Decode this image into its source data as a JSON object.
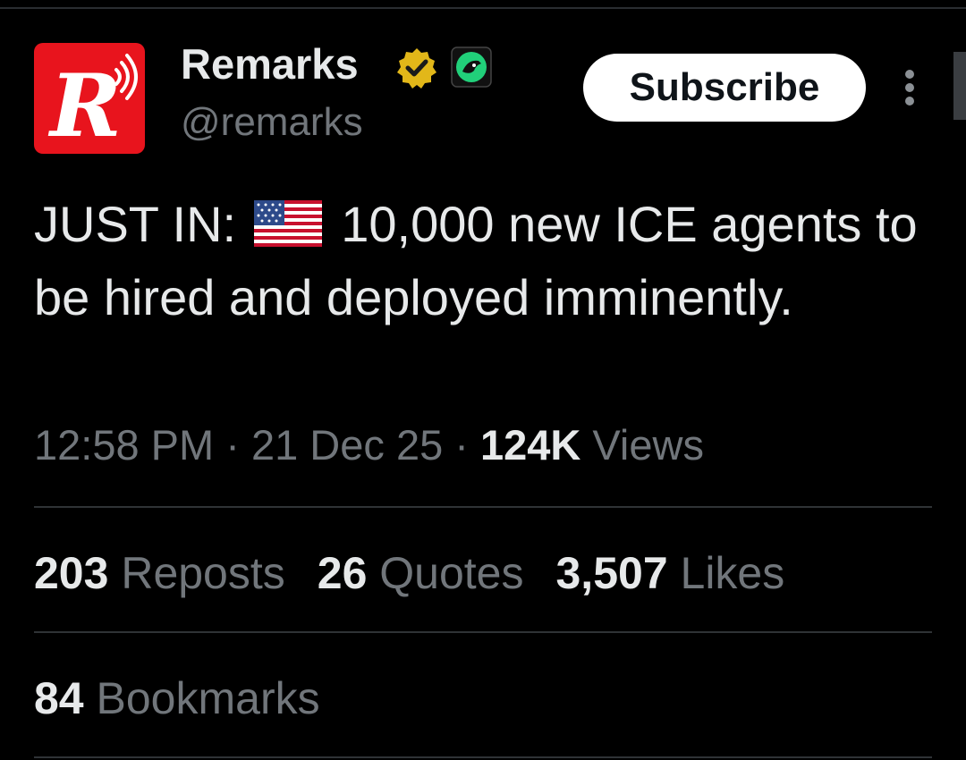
{
  "author": {
    "name": "Remarks",
    "handle": "@remarks",
    "avatar_letter": "R",
    "verified_icon": "gold-verified-badge-icon",
    "affiliate_icon": "green-affiliate-logo-icon"
  },
  "header": {
    "subscribe_label": "Subscribe",
    "more_icon": "vertical-dots-icon"
  },
  "tweet": {
    "text_before_flag": "JUST IN: ",
    "flag_icon": "us-flag-icon",
    "text_after_flag": " 10,000 new ICE agents to be hired and deployed imminently."
  },
  "meta": {
    "time": "12:58 PM",
    "separator": " · ",
    "date": "21 Dec 25",
    "views_count": "124K",
    "views_label": " Views"
  },
  "stats": {
    "reposts_count": "203",
    "reposts_label": " Reposts",
    "quotes_count": "26",
    "quotes_label": " Quotes",
    "likes_count": "3,507",
    "likes_label": " Likes",
    "bookmarks_count": "84",
    "bookmarks_label": " Bookmarks"
  },
  "colors": {
    "background": "#000000",
    "text_primary": "#e7e9ea",
    "text_secondary": "#71767b",
    "brand_red": "#e8141d",
    "verified_gold": "#e2b719",
    "affiliate_green": "#21d07a"
  }
}
